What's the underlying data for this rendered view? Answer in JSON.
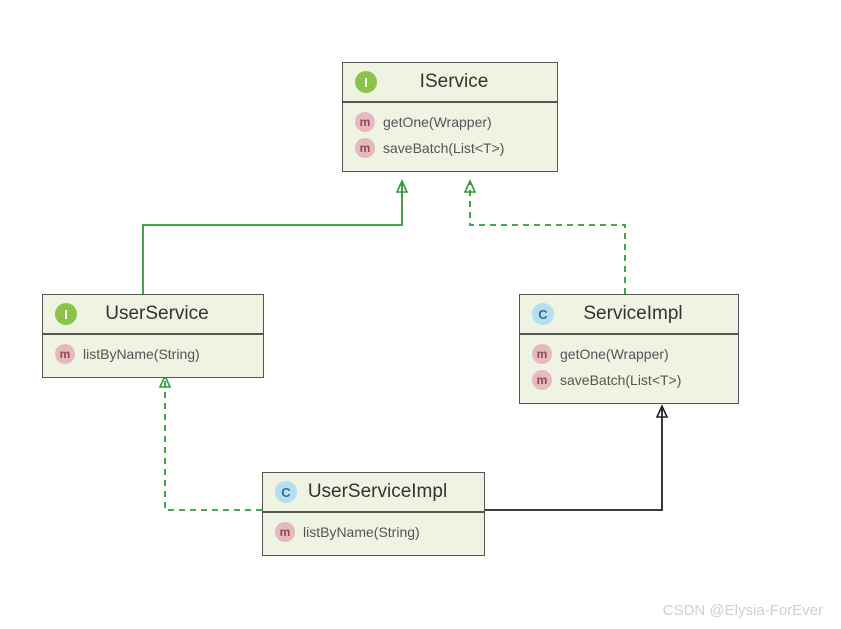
{
  "classes": {
    "iservice": {
      "kind": "I",
      "name": "IService",
      "members": [
        {
          "kind": "m",
          "sig": "getOne(Wrapper)"
        },
        {
          "kind": "m",
          "sig": "saveBatch(List<T>)"
        }
      ]
    },
    "userservice": {
      "kind": "I",
      "name": "UserService",
      "members": [
        {
          "kind": "m",
          "sig": "listByName(String)"
        }
      ]
    },
    "serviceimpl": {
      "kind": "C",
      "name": "ServiceImpl",
      "members": [
        {
          "kind": "m",
          "sig": "getOne(Wrapper)"
        },
        {
          "kind": "m",
          "sig": "saveBatch(List<T>)"
        }
      ]
    },
    "userserviceimpl": {
      "kind": "C",
      "name": "UserServiceImpl",
      "members": [
        {
          "kind": "m",
          "sig": "listByName(String)"
        }
      ]
    }
  },
  "relations": [
    {
      "from": "userservice",
      "to": "iservice",
      "style": "solid",
      "color": "green",
      "meaning": "extends-interface"
    },
    {
      "from": "serviceimpl",
      "to": "iservice",
      "style": "dashed",
      "color": "green",
      "meaning": "implements"
    },
    {
      "from": "userserviceimpl",
      "to": "userservice",
      "style": "dashed",
      "color": "green",
      "meaning": "implements"
    },
    {
      "from": "userserviceimpl",
      "to": "serviceimpl",
      "style": "solid",
      "color": "black",
      "meaning": "extends-class"
    }
  ],
  "watermark": "CSDN @Elysia-ForEver",
  "colors": {
    "boxFill": "#eef3e2",
    "interfaceBadge": "#8bc34a",
    "classBadge": "#b3dff0",
    "methodBadge": "#e6b8c0",
    "greenLine": "#339933",
    "blackLine": "#222222"
  }
}
